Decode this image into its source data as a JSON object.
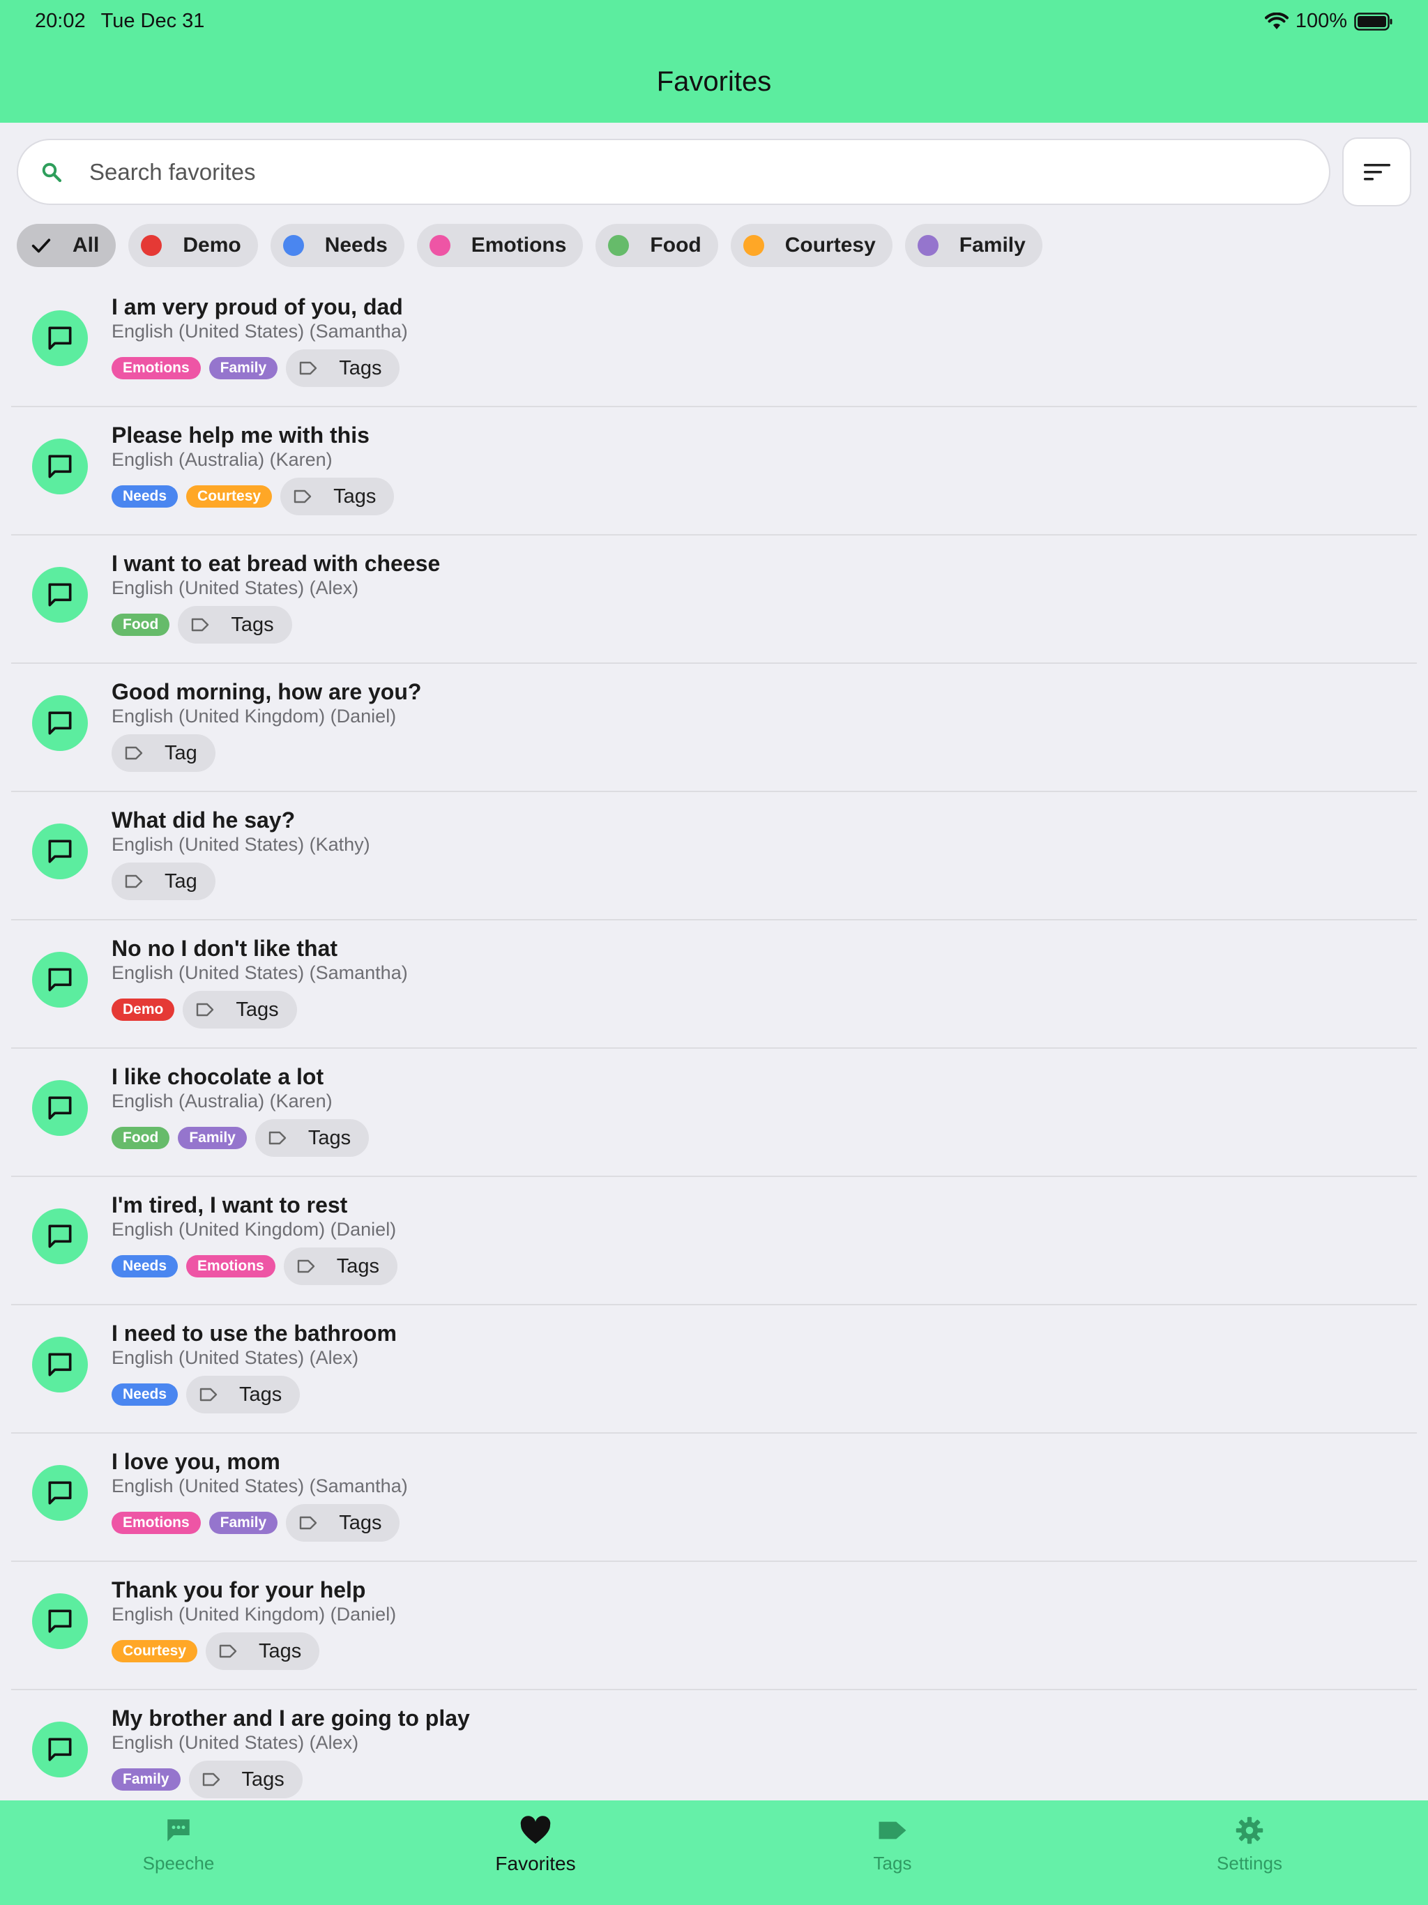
{
  "status_bar": {
    "time": "20:02",
    "date": "Tue Dec 31",
    "battery": "100%"
  },
  "header": {
    "title": "Favorites"
  },
  "search": {
    "placeholder": "Search favorites",
    "value": ""
  },
  "filters": [
    {
      "label": "All",
      "selected": true,
      "color": ""
    },
    {
      "label": "Demo",
      "color": "#e53935"
    },
    {
      "label": "Needs",
      "color": "#4a86f0"
    },
    {
      "label": "Emotions",
      "color": "#ee55a5"
    },
    {
      "label": "Food",
      "color": "#66bb6a"
    },
    {
      "label": "Courtesy",
      "color": "#ffa726"
    },
    {
      "label": "Family",
      "color": "#9575cd"
    }
  ],
  "favorites": [
    {
      "phrase": "I am very proud of you, dad",
      "voice": "English (United States) (Samantha)",
      "tags": [
        "Emotions",
        "Family"
      ],
      "tag_button": "Tags"
    },
    {
      "phrase": "Please help me with this",
      "voice": "English (Australia) (Karen)",
      "tags": [
        "Needs",
        "Courtesy"
      ],
      "tag_button": "Tags"
    },
    {
      "phrase": "I want to eat bread with cheese",
      "voice": "English (United States) (Alex)",
      "tags": [
        "Food"
      ],
      "tag_button": "Tags"
    },
    {
      "phrase": "Good morning, how are you?",
      "voice": "English (United Kingdom) (Daniel)",
      "tags": [],
      "tag_button": "Tag"
    },
    {
      "phrase": "What did he say?",
      "voice": "English (United States) (Kathy)",
      "tags": [],
      "tag_button": "Tag"
    },
    {
      "phrase": "No no I don't like that",
      "voice": "English (United States) (Samantha)",
      "tags": [
        "Demo"
      ],
      "tag_button": "Tags"
    },
    {
      "phrase": "I like chocolate a lot",
      "voice": "English (Australia) (Karen)",
      "tags": [
        "Food",
        "Family"
      ],
      "tag_button": "Tags"
    },
    {
      "phrase": "I'm tired, I want to rest",
      "voice": "English (United Kingdom) (Daniel)",
      "tags": [
        "Needs",
        "Emotions"
      ],
      "tag_button": "Tags"
    },
    {
      "phrase": "I need to use the bathroom",
      "voice": "English (United States) (Alex)",
      "tags": [
        "Needs"
      ],
      "tag_button": "Tags"
    },
    {
      "phrase": "I love you, mom",
      "voice": "English (United States) (Samantha)",
      "tags": [
        "Emotions",
        "Family"
      ],
      "tag_button": "Tags"
    },
    {
      "phrase": "Thank you for your help",
      "voice": "English (United Kingdom) (Daniel)",
      "tags": [
        "Courtesy"
      ],
      "tag_button": "Tags"
    },
    {
      "phrase": "My brother and I are going to play",
      "voice": "English (United States) (Alex)",
      "tags": [
        "Family"
      ],
      "tag_button": "Tags"
    }
  ],
  "tab_bar": {
    "items": [
      {
        "label": "Speeche",
        "icon": "speech-bubble-icon",
        "active": false
      },
      {
        "label": "Favorites",
        "icon": "heart-icon",
        "active": true
      },
      {
        "label": "Tags",
        "icon": "tag-icon",
        "active": false
      },
      {
        "label": "Settings",
        "icon": "gear-icon",
        "active": false
      }
    ]
  }
}
